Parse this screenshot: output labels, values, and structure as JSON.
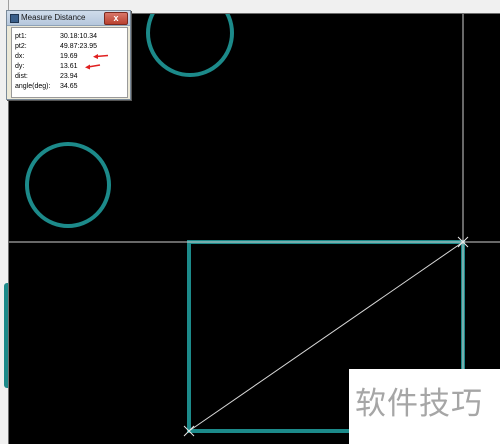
{
  "measure_dialog": {
    "title": "Measure Distance",
    "close_label": "x",
    "rows": [
      {
        "label": "pt1:",
        "value": "30.18:10.34"
      },
      {
        "label": "pt2:",
        "value": "49.87:23.95"
      },
      {
        "label": "dx:",
        "value": "19.69"
      },
      {
        "label": "dy:",
        "value": "13.61"
      },
      {
        "label": "dist:",
        "value": "23.94"
      },
      {
        "label": "angle(deg):",
        "value": "34.65"
      }
    ]
  },
  "watermark": {
    "text": "软件技巧"
  },
  "colors": {
    "background": "#000000",
    "shape_stroke": "#1c8a8a",
    "crosshair": "#d0d0d0",
    "annotation_arrow": "#e02020"
  }
}
